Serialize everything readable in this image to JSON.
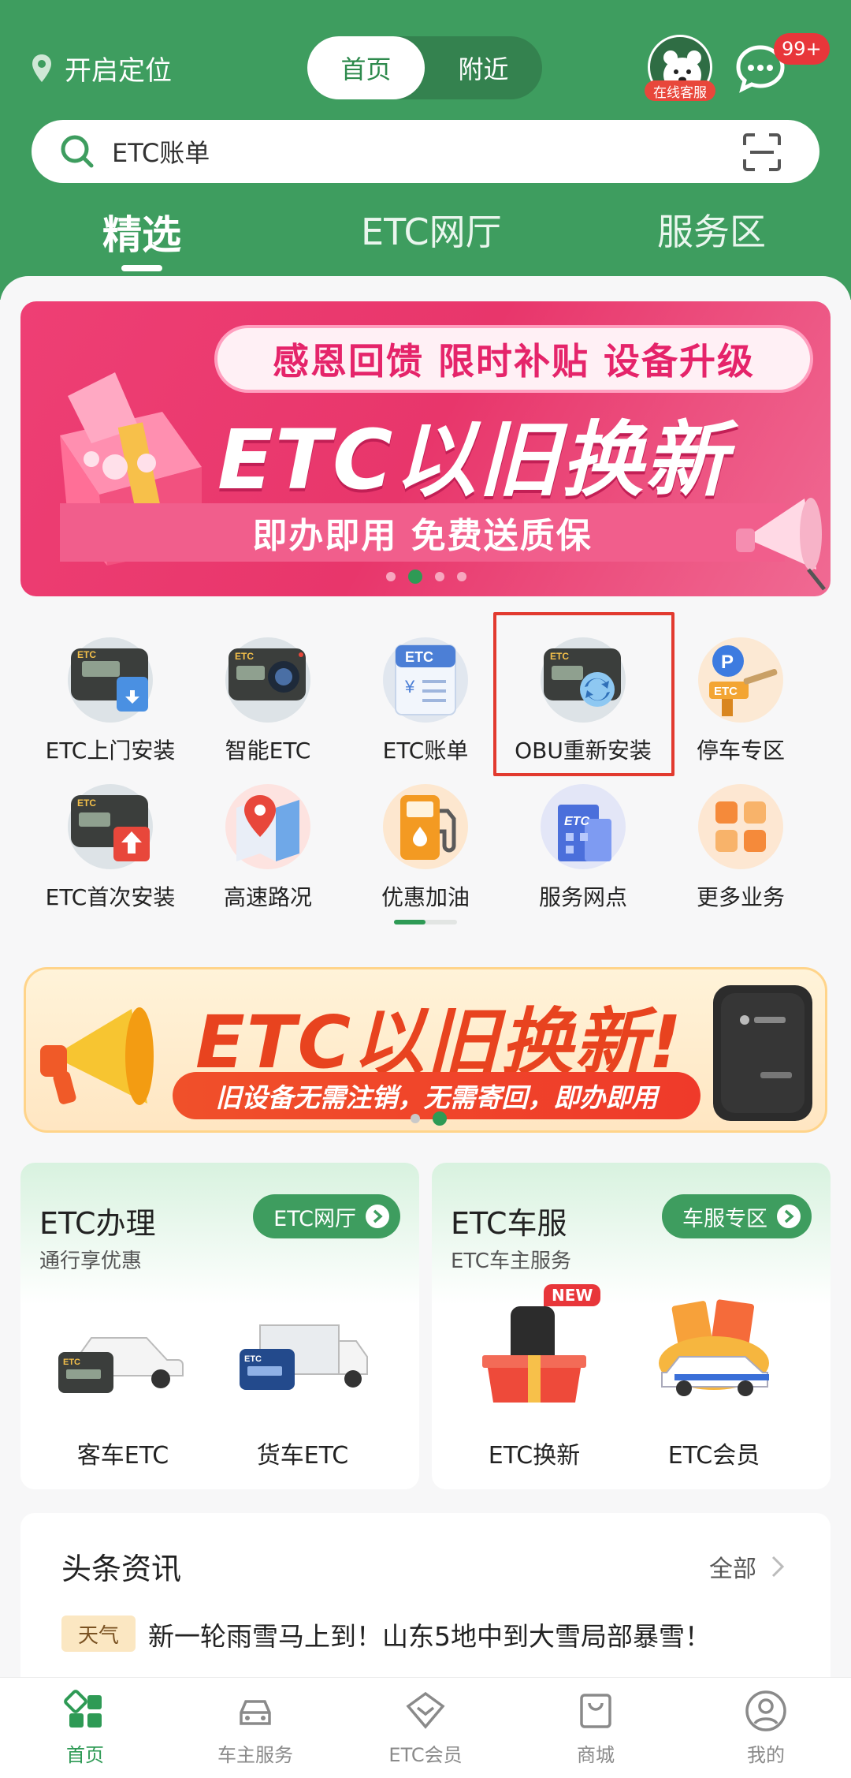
{
  "header": {
    "location_label": "开启定位",
    "segments": [
      "首页",
      "附近"
    ],
    "active_segment": "首页",
    "customer_service_label": "在线客服",
    "message_badge": "99+",
    "search_text": "ETC账单"
  },
  "tabs": [
    {
      "label": "精选",
      "active": true
    },
    {
      "label": "ETC网厅",
      "active": false
    },
    {
      "label": "服务区",
      "active": false
    }
  ],
  "banner1": {
    "pill_text": "感恩回馈  限时补贴  设备升级",
    "big_text": "ETC以旧换新",
    "strip_text": "即办即用  免费送质保",
    "page_count": 4,
    "active_page": 2
  },
  "services": [
    {
      "label": "ETC上门安装",
      "icon": "etc-home-install-icon"
    },
    {
      "label": "智能ETC",
      "icon": "smart-etc-icon"
    },
    {
      "label": "ETC账单",
      "icon": "etc-bill-icon"
    },
    {
      "label": "OBU重新安装",
      "icon": "obu-reinstall-icon"
    },
    {
      "label": "停车专区",
      "icon": "parking-icon"
    },
    {
      "label": "ETC首次安装",
      "icon": "etc-first-install-icon"
    },
    {
      "label": "高速路况",
      "icon": "highway-map-icon"
    },
    {
      "label": "优惠加油",
      "icon": "fuel-icon"
    },
    {
      "label": "服务网点",
      "icon": "service-outlet-icon"
    },
    {
      "label": "更多业务",
      "icon": "more-grid-icon"
    }
  ],
  "banner2": {
    "title": "ETC以旧换新!",
    "strip_text": "旧设备无需注销，无需寄回，即办即用",
    "page_count": 2,
    "active_page": 2
  },
  "cards": [
    {
      "title": "ETC办理",
      "subtitle": "通行享优惠",
      "button": "ETC网厅",
      "items": [
        {
          "label": "客车ETC",
          "icon": "car-etc-icon"
        },
        {
          "label": "货车ETC",
          "icon": "truck-etc-icon"
        }
      ]
    },
    {
      "title": "ETC车服",
      "subtitle": "ETC车主服务",
      "button": "车服专区",
      "items": [
        {
          "label": "ETC换新",
          "icon": "etc-renew-icon",
          "badge": "NEW"
        },
        {
          "label": "ETC会员",
          "icon": "etc-member-gift-icon"
        }
      ]
    }
  ],
  "news": {
    "title": "头条资讯",
    "all_label": "全部",
    "tag": "天气",
    "headline": "新一轮雨雪马上到！山东5地中到大雪局部暴雪！"
  },
  "bottom_nav": [
    {
      "label": "首页",
      "icon": "home-icon",
      "active": true
    },
    {
      "label": "车主服务",
      "icon": "car-service-icon",
      "active": false
    },
    {
      "label": "ETC会员",
      "icon": "diamond-icon",
      "active": false
    },
    {
      "label": "商城",
      "icon": "shopping-bag-icon",
      "active": false
    },
    {
      "label": "我的",
      "icon": "profile-icon",
      "active": false
    }
  ],
  "colors": {
    "brand_green": "#3e9d5f",
    "banner_pink": "#e8366b",
    "highlight_red": "#e23a2f",
    "banner_orange": "#e8431f"
  }
}
